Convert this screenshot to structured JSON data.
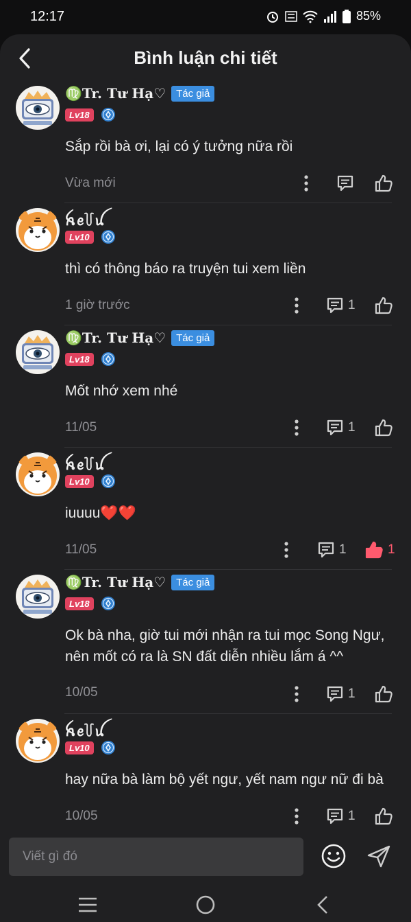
{
  "status": {
    "time": "12:17",
    "battery": "85%"
  },
  "header": {
    "title": "Bình luận chi tiết"
  },
  "comments": [
    {
      "author": "♍Tr. Tư Hạ♡",
      "is_author": true,
      "author_tag": "Tác giả",
      "level": "Lv18",
      "text": "Sắp rồi bà ơi, lại có ý tưởng nữa rồi",
      "time": "Vừa mới",
      "reply_count": "",
      "like_count": "",
      "liked": false
    },
    {
      "author": "ꫝꫀ꒦ꪊ",
      "is_author": false,
      "author_tag": "",
      "level": "Lv10",
      "text": "thì có thông báo ra truyện tui xem liền",
      "time": "1 giờ trước",
      "reply_count": "1",
      "like_count": "",
      "liked": false
    },
    {
      "author": "♍Tr. Tư Hạ♡",
      "is_author": true,
      "author_tag": "Tác giả",
      "level": "Lv18",
      "text": "Mốt nhớ xem nhé",
      "time": "11/05",
      "reply_count": "1",
      "like_count": "",
      "liked": false
    },
    {
      "author": "ꫝꫀ꒦ꪊ",
      "is_author": false,
      "author_tag": "",
      "level": "Lv10",
      "text": "iuuuu❤️❤️",
      "time": "11/05",
      "reply_count": "1",
      "like_count": "1",
      "liked": true
    },
    {
      "author": "♍Tr. Tư Hạ♡",
      "is_author": true,
      "author_tag": "Tác giả",
      "level": "Lv18",
      "text": "Ok bà nha, giờ tui mới nhận ra tui mọc Song Ngư, nên mốt có ra là SN đất diễn nhiều lắm á ^^",
      "time": "10/05",
      "reply_count": "1",
      "like_count": "",
      "liked": false
    },
    {
      "author": "ꫝꫀ꒦ꪊ",
      "is_author": false,
      "author_tag": "",
      "level": "Lv10",
      "text": "hay nữa bà làm bộ yết ngư, yết nam ngư nữ đi bà",
      "time": "10/05",
      "reply_count": "1",
      "like_count": "",
      "liked": false
    }
  ],
  "composer": {
    "placeholder": "Viết gì đó"
  },
  "colors": {
    "accent": "#3b8ee0",
    "level": "#e0425e",
    "like_active": "#ff5a6e",
    "panel": "#202022"
  },
  "icons": {
    "back": "chevron-left-icon",
    "more": "more-vertical-icon",
    "reply": "comment-icon",
    "like": "thumbs-up-icon",
    "emoji": "smiley-icon",
    "send": "send-icon"
  }
}
